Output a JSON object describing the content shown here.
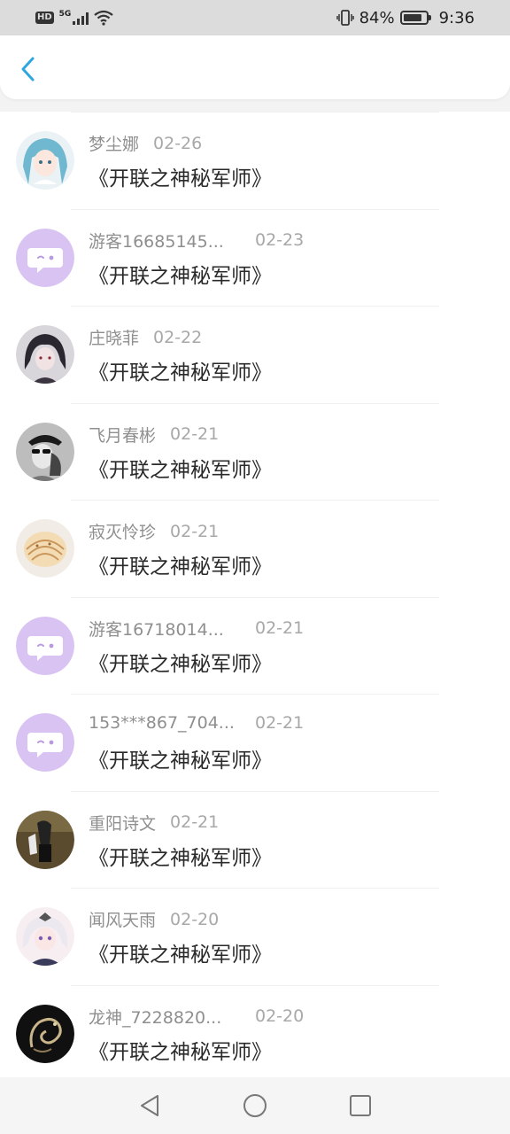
{
  "status_bar": {
    "hd": "HD",
    "network": "5G",
    "battery_percent": "84%",
    "battery_level": 0.84,
    "time": "9:36",
    "icons": [
      "hd-icon",
      "signal-icon",
      "wifi-icon",
      "vibrate-icon",
      "battery-icon"
    ]
  },
  "header": {
    "back_icon": "chevron-left-icon",
    "accent_color": "#2ea7e0"
  },
  "readers": [
    {
      "name": "梦尘娜",
      "date": "02-26",
      "book": "《开联之神秘军师》",
      "avatar": "anime-girl-teal"
    },
    {
      "name": "游客16685145...",
      "date": "02-23",
      "book": "《开联之神秘军师》",
      "avatar": "default-chat"
    },
    {
      "name": "庄晓菲",
      "date": "02-22",
      "book": "《开联之神秘军师》",
      "avatar": "dark-hair-anime"
    },
    {
      "name": "飞月春彬",
      "date": "02-21",
      "book": "《开联之神秘军师》",
      "avatar": "bw-sunglasses"
    },
    {
      "name": "寂灭怜珍",
      "date": "02-21",
      "book": "《开联之神秘军师》",
      "avatar": "seashell"
    },
    {
      "name": "游客16718014...",
      "date": "02-21",
      "book": "《开联之神秘军师》",
      "avatar": "default-chat"
    },
    {
      "name": "153***867_704...",
      "date": "02-21",
      "book": "《开联之神秘军师》",
      "avatar": "default-chat"
    },
    {
      "name": "重阳诗文",
      "date": "02-21",
      "book": "《开联之神秘军师》",
      "avatar": "photo-person"
    },
    {
      "name": "闻风天雨",
      "date": "02-20",
      "book": "《开联之神秘军师》",
      "avatar": "anime-white-hair"
    },
    {
      "name": "龙神_7228820...",
      "date": "02-20",
      "book": "《开联之神秘军师》",
      "avatar": "dragon"
    }
  ],
  "nav_bar": {
    "icons": [
      "back-triangle-icon",
      "home-circle-icon",
      "recent-square-icon"
    ]
  }
}
